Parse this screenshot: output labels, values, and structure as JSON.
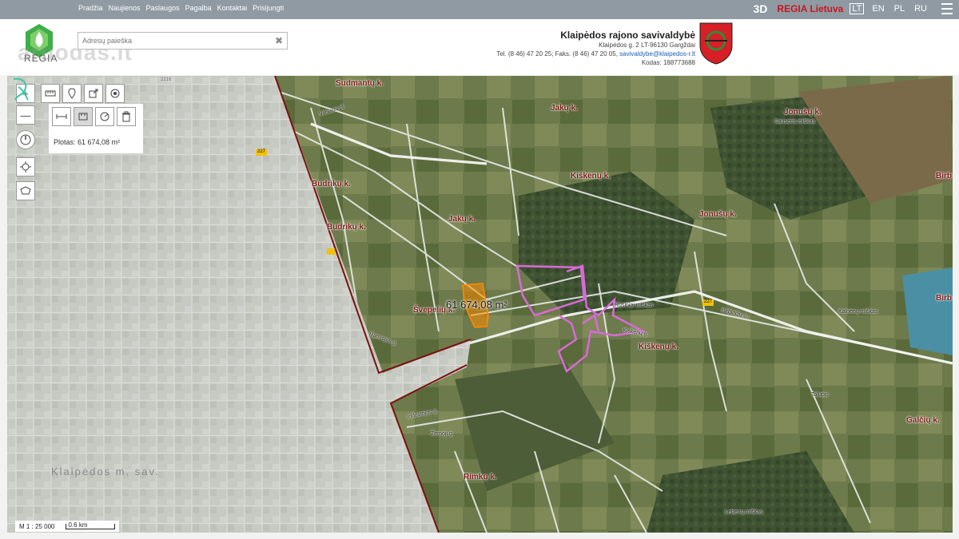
{
  "topbar": {
    "nav": [
      "Pradžia",
      "Naujienos",
      "Paslaugos",
      "Pagalba",
      "Kontaktai",
      "Prisijungti"
    ],
    "mode_3d": "3D",
    "brand": "REGIA Lietuva",
    "languages": [
      "LT",
      "EN",
      "PL",
      "RU"
    ],
    "active_language": "LT"
  },
  "header": {
    "logo_text": "REGIA",
    "watermark": "aruodas.lt",
    "search_placeholder": "Adresų paieška",
    "municipality": {
      "name": "Klaipėdos rajono savivaldybė",
      "address": "Klaipėdos g. 2 LT-96130 Gargždai",
      "phone_fax": "Tel. (8 46) 47 20 25; Faks. (8 46) 47 20 05,",
      "email": "savivaldybe@klaipedos-r.lt",
      "code": "Kodas: 188773688"
    }
  },
  "tools": {
    "area_readout": "Plotas: 61 674,08 m²"
  },
  "map": {
    "area_label": "61 674,08 m²",
    "scale": "M 1 : 25 000",
    "scale_bar_label": "0.6 km",
    "city_watermark": "Klaipėdos m. sav.",
    "places": [
      "Sudmantų k.",
      "Jakų k.",
      "Jonušų k.",
      "Kiškėnų k.",
      "Budrikų k.",
      "Jakų k.",
      "Jonušų k.",
      "Budrikų k.",
      "Švepelių k.",
      "Kiškėnų k.",
      "Rimkų k.",
      "Galčių k.",
      "Birb"
    ],
    "small_labels": [
      "Vilniaus pl.",
      "Birbinčių g.",
      "Talupis",
      "Industrijos g.",
      "Žemoji g.",
      "Ramiojos g.",
      "Kiškėnų g.",
      "Sauseris miškas",
      "Kalnėnų miškas",
      "Lebertų miškas",
      "Rusiniai miškas"
    ],
    "roads": [
      "227",
      "141",
      "2216"
    ]
  }
}
